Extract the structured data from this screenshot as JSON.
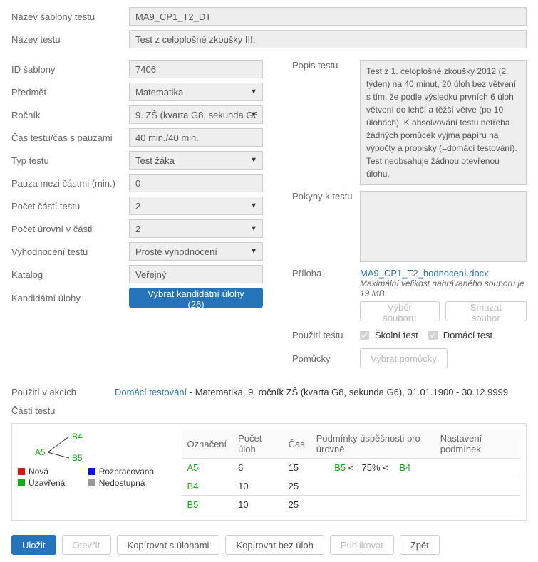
{
  "labels": {
    "template_name": "Název šablony testu",
    "test_name": "Název testu",
    "template_id": "ID šablony",
    "subject": "Předmět",
    "grade": "Ročník",
    "time": "Čas testu/čas s pauzami",
    "test_type": "Typ testu",
    "pause": "Pauza mezi částmi (min.)",
    "parts_count": "Počet částí testu",
    "levels_count": "Počet úrovní v části",
    "evaluation": "Vyhodnocení testu",
    "catalog": "Katalog",
    "candidate": "Kandidátní úlohy",
    "description": "Popis testu",
    "instructions": "Pokyny k testu",
    "attachment": "Příloha",
    "usage": "Použití testu",
    "aids": "Pomůcky",
    "used_in": "Použití v akcích",
    "parts": "Části testu"
  },
  "values": {
    "template_name": "MA9_CP1_T2_DT",
    "test_name": "Test z celoplošné zkoušky III.",
    "template_id": "7406",
    "subject": "Matematika",
    "grade": "9. ZŠ (kvarta G8, sekunda G6)",
    "time": "40 min./40 min.",
    "test_type": "Test žáka",
    "pause": "0",
    "parts_count": "2",
    "levels_count": "2",
    "evaluation": "Prosté vyhodnocení",
    "catalog": "Veřejný",
    "description": "Test z 1. celoplošné zkoušky 2012 (2. týden) na 40 minut, 20 úloh bez větvení s tím, že podle výsledku prvních 6 úloh větvení do lehčí a těžší větve (po 10 úlohách). K absolvování testu netřeba žádných pomůcek vyjma papíru na výpočty a propisky (=domácí testování). Test neobsahuje žádnou otevřenou úlohu.",
    "attachment_file": "MA9_CP1_T2_hodnocení.docx",
    "attachment_note": "Maximální velikost nahrávaného souboru je 19 MB.",
    "usage_school": "Školní test",
    "usage_home": "Domácí test",
    "used_in_link": "Domácí testování",
    "used_in_rest": " - Matematika, 9. ročník ZŠ (kvarta G8, sekunda G6), 01.01.1900 - 30.12.9999"
  },
  "buttons": {
    "candidate": "Vybrat kandidátní úlohy (26)",
    "select_file": "Výběr souboru",
    "delete_file": "Smazat soubor",
    "select_aids": "Vybrat pomůcky",
    "save": "Uložit",
    "open": "Otevřít",
    "copy_with": "Kopírovat s úlohami",
    "copy_without": "Kopírovat bez úloh",
    "publish": "Publikovat",
    "back": "Zpět"
  },
  "tree": {
    "a5": "A5",
    "b4": "B4",
    "b5": "B5"
  },
  "legend": {
    "new": "Nová",
    "draft": "Rozpracovaná",
    "closed": "Uzavřená",
    "unavailable": "Nedostupná"
  },
  "table": {
    "headers": {
      "label": "Označení",
      "count": "Počet úloh",
      "time": "Čas",
      "conditions": "Podmínky úspěšnosti pro úrovně",
      "settings": "Nastavení podmínek"
    },
    "rows": [
      {
        "label": "A5",
        "count": "6",
        "time": "15",
        "cond_left": "B5",
        "cond_mid": " <= 75% < ",
        "cond_right": "B4"
      },
      {
        "label": "B4",
        "count": "10",
        "time": "25",
        "cond_left": "",
        "cond_mid": "",
        "cond_right": ""
      },
      {
        "label": "B5",
        "count": "10",
        "time": "25",
        "cond_left": "",
        "cond_mid": "",
        "cond_right": ""
      }
    ]
  }
}
